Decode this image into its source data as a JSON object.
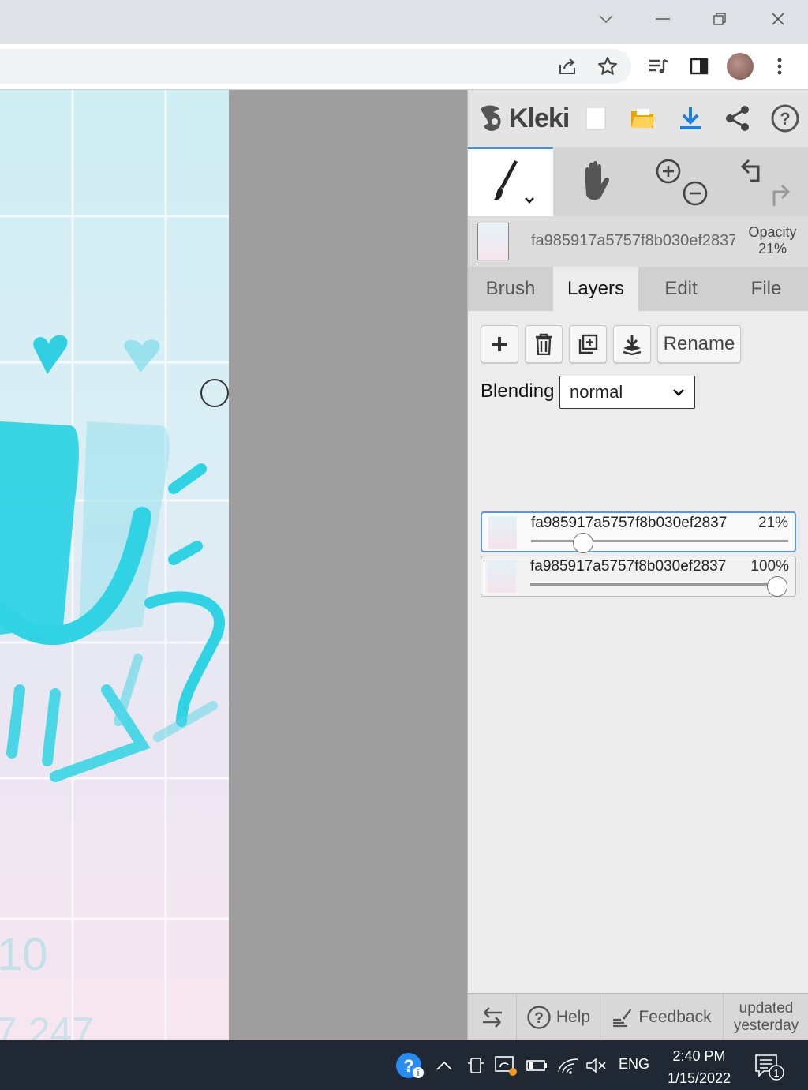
{
  "kleki": {
    "logo_text": "Kleki"
  },
  "layer_info": {
    "name": "fa985917a5757f8b030ef2837",
    "opacity_label": "Opacity",
    "opacity_value": "21%"
  },
  "tabs": [
    {
      "label": "Brush"
    },
    {
      "label": "Layers"
    },
    {
      "label": "Edit"
    },
    {
      "label": "File"
    }
  ],
  "layers_panel": {
    "rename_label": "Rename",
    "blending_label": "Blending",
    "blending_value": "normal",
    "layers": [
      {
        "name": "fa985917a5757f8b030ef2837",
        "opacity": "21%",
        "opacity_fraction": 0.21,
        "selected": true
      },
      {
        "name": "fa985917a5757f8b030ef2837",
        "opacity": "100%",
        "opacity_fraction": 1.0,
        "selected": false
      }
    ]
  },
  "bottom_bar": {
    "help_label": "Help",
    "feedback_label": "Feedback",
    "updated_line1": "updated",
    "updated_line2": "yesterday"
  },
  "taskbar": {
    "language": "ENG",
    "time": "2:40 PM",
    "date": "1/15/2022",
    "notification_count": "1"
  },
  "canvas_art": {
    "number_text": "10",
    "bottom_text": "7 247"
  },
  "colors": {
    "accent_blue": "#4b8fe3",
    "drawing_cyan": "#2fd3e4",
    "taskbar": "#1f2833"
  }
}
